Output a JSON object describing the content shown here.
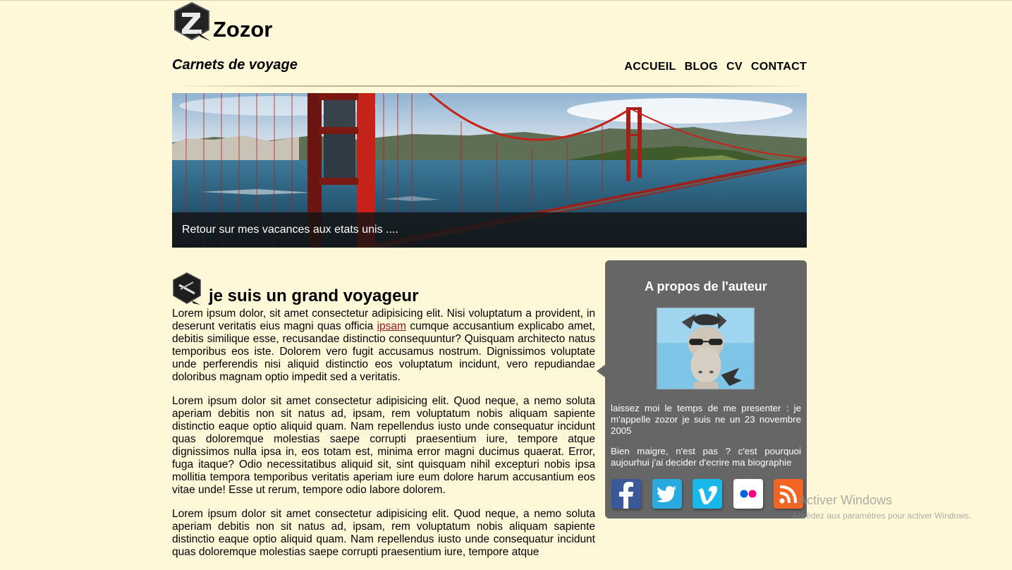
{
  "brand": {
    "name": "Zozor"
  },
  "header": {
    "tagline": "Carnets de voyage",
    "nav": [
      "ACCUEIL",
      "BLOG",
      "CV",
      "CONTACT"
    ]
  },
  "banner": {
    "caption": "Retour sur mes vacances aux etats unis ...."
  },
  "article": {
    "title": "je suis un grand voyageur",
    "p1_before": "Lorem ipsum dolor, sit amet consectetur adipisicing elit. Nisi voluptatum a provident, in deserunt veritatis eius magni quas officia ",
    "p1_link": "ipsam",
    "p1_after": " cumque accusantium explicabo amet, debitis similique esse, recusandae distinctio consequuntur? Quisquam architecto natus temporibus eos iste. Dolorem vero fugit accusamus nostrum. Dignissimos voluptate unde perferendis nisi aliquid distinctio eos voluptatum incidunt, vero repudiandae doloribus magnam optio impedit sed a veritatis.",
    "p2": "Lorem ipsum dolor sit amet consectetur adipisicing elit. Quod neque, a nemo soluta aperiam debitis non sit natus ad, ipsam, rem voluptatum nobis aliquam sapiente distinctio eaque optio aliquid quam. Nam repellendus iusto unde consequatur incidunt quas doloremque molestias saepe corrupti praesentium iure, tempore atque dignissimos nulla ipsa in, eos totam est, minima error magni ducimus quaerat. Error, fuga itaque? Odio necessitatibus aliquid sit, sint quisquam nihil excepturi nobis ipsa mollitia tempora temporibus veritatis aperiam iure eum dolore harum accusantium eos vitae unde! Esse ut rerum, tempore odio labore dolorem.",
    "p3": "Lorem ipsum dolor sit amet consectetur adipisicing elit. Quod neque, a nemo soluta aperiam debitis non sit natus ad, ipsam, rem voluptatum nobis aliquam sapiente distinctio eaque optio aliquid quam. Nam repellendus iusto unde consequatur incidunt quas doloremque molestias saepe corrupti praesentium iure, tempore atque"
  },
  "aside": {
    "title": "A propos de l'auteur",
    "p1": "laissez moi le temps de me presenter : je m'appelle zozor je suis ne un 23 novembre 2005",
    "p2": "Bien maigre, n'est pas ? c'est pourquoi aujourhui j'ai decider d'ecrire ma biographie",
    "social": [
      {
        "name": "facebook-icon",
        "glyph": "f",
        "color": "#3b5998"
      },
      {
        "name": "twitter-icon",
        "glyph": "",
        "color": "#2aa9e0"
      },
      {
        "name": "vimeo-icon",
        "glyph": "v",
        "color": "#1ab7ea"
      },
      {
        "name": "flickr-icon",
        "glyph": "",
        "color": "#ffffff"
      },
      {
        "name": "rss-icon",
        "glyph": "",
        "color": "#f26522"
      }
    ]
  },
  "watermark": {
    "line1": "Activer Windows",
    "line2": "Accédez aux paramètres pour activer Windows."
  }
}
